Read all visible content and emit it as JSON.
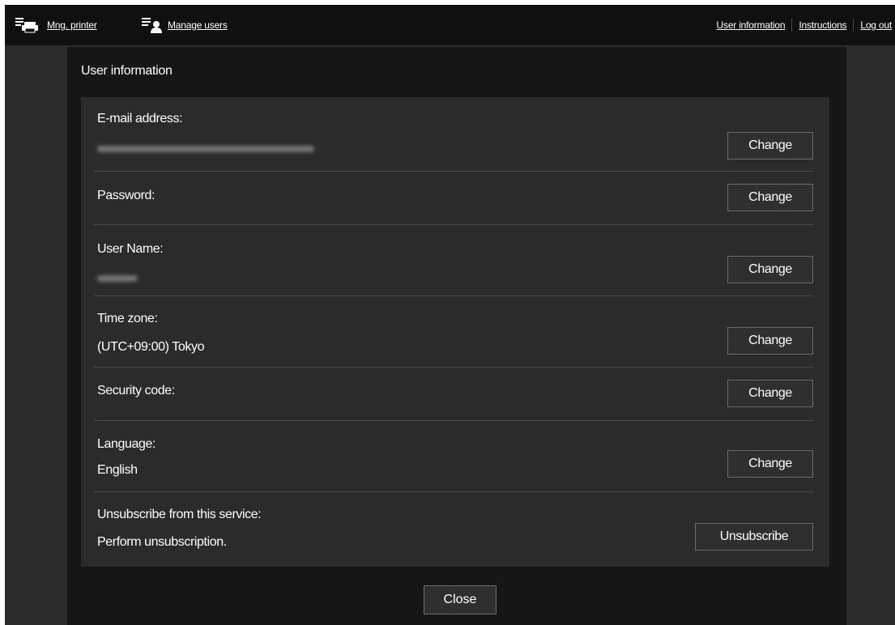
{
  "topbar": {
    "mng_printer": {
      "label": "Mng. printer",
      "icon": "printer-list-icon"
    },
    "manage_users": {
      "label": "Manage users",
      "icon": "user-list-icon"
    },
    "links": [
      {
        "label": "User information"
      },
      {
        "label": "Instructions"
      },
      {
        "label": "Log out"
      }
    ]
  },
  "dialog": {
    "title": "User information",
    "rows": [
      {
        "label": "E-mail address:",
        "value_blurred": true,
        "button": "Change"
      },
      {
        "label": "Password:",
        "button": "Change"
      },
      {
        "label": "User Name:",
        "value_blurred": true,
        "button": "Change"
      },
      {
        "label": "Time zone:",
        "value": "(UTC+09:00) Tokyo",
        "button": "Change"
      },
      {
        "label": "Security code:",
        "button": "Change"
      },
      {
        "label": "Language:",
        "value": "English",
        "button": "Change"
      },
      {
        "label": "Unsubscribe from this service:",
        "value": "Perform unsubscription.",
        "button": "Unsubscribe"
      }
    ],
    "close_label": "Close"
  },
  "colors": {
    "background": "#2b2b2b",
    "topbar": "#101010",
    "dialog": "#161616",
    "panel": "#2b2b2b",
    "text": "#ffffff"
  }
}
